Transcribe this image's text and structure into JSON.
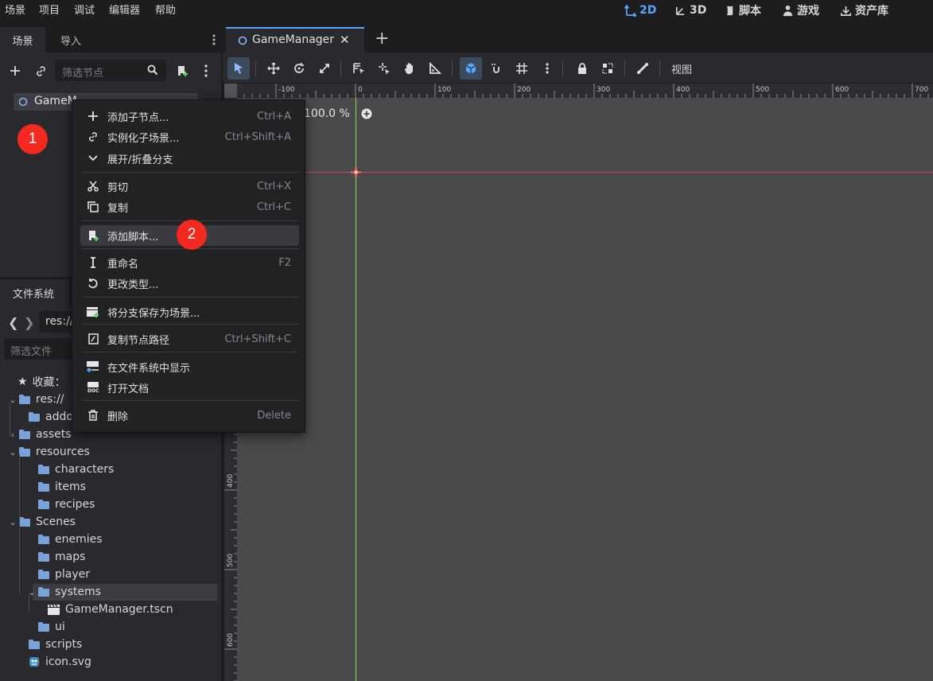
{
  "menubar": {
    "items": [
      "场景",
      "项目",
      "调试",
      "编辑器",
      "帮助"
    ],
    "workspaces": [
      "2D",
      "3D",
      "脚本",
      "游戏",
      "资产库"
    ]
  },
  "scene_dock": {
    "tabs": [
      "场景",
      "导入"
    ],
    "filter_placeholder": "筛选节点",
    "root_node": "GameM"
  },
  "editor_tab": {
    "title": "GameManager",
    "close": "✕",
    "add": "+"
  },
  "toolbar": {
    "view_label": "视图"
  },
  "rulers": {
    "h_labels": [
      "-100",
      "0",
      "100",
      "200",
      "300",
      "400",
      "500",
      "600",
      "700"
    ],
    "v_labels": [
      "400",
      "500",
      "600"
    ]
  },
  "viewport": {
    "zoom": "100.0 %"
  },
  "context_menu": {
    "items": [
      {
        "label": "添加子节点...",
        "shortcut": "Ctrl+A",
        "icon": "plus-icon"
      },
      {
        "label": "实例化子场景...",
        "shortcut": "Ctrl+Shift+A",
        "icon": "link-icon"
      },
      {
        "label": "展开/折叠分支",
        "shortcut": "",
        "icon": "chevron-down-icon"
      },
      {
        "label": "剪切",
        "shortcut": "Ctrl+X",
        "icon": "scissors-icon"
      },
      {
        "label": "复制",
        "shortcut": "Ctrl+C",
        "icon": "copy-icon"
      },
      {
        "label": "添加脚本...",
        "shortcut": "",
        "icon": "script-add-icon"
      },
      {
        "label": "重命名",
        "shortcut": "F2",
        "icon": "text-cursor-icon"
      },
      {
        "label": "更改类型...",
        "shortcut": "",
        "icon": "reload-icon"
      },
      {
        "label": "将分支保存为场景...",
        "shortcut": "",
        "icon": "save-scene-icon"
      },
      {
        "label": "复制节点路径",
        "shortcut": "Ctrl+Shift+C",
        "icon": "copy-path-icon"
      },
      {
        "label": "在文件系统中显示",
        "shortcut": "",
        "icon": "filesystem-icon"
      },
      {
        "label": "打开文档",
        "shortcut": "",
        "icon": "doc-icon"
      },
      {
        "label": "删除",
        "shortcut": "Delete",
        "icon": "trash-icon"
      }
    ]
  },
  "annotations": {
    "badge1": "1",
    "badge2": "2"
  },
  "filesystem": {
    "tab": "文件系统",
    "path": "res://",
    "filter_placeholder": "筛选文件",
    "favorites": "收藏：",
    "tree": [
      {
        "label": "res://",
        "caret": "v",
        "type": "folder"
      },
      {
        "label": "addons",
        "caret": "",
        "type": "folder"
      },
      {
        "label": "assets",
        "caret": ">",
        "type": "folder"
      },
      {
        "label": "resources",
        "caret": "v",
        "type": "folder"
      },
      {
        "label": "characters",
        "caret": "",
        "type": "folder"
      },
      {
        "label": "items",
        "caret": "",
        "type": "folder"
      },
      {
        "label": "recipes",
        "caret": "",
        "type": "folder"
      },
      {
        "label": "Scenes",
        "caret": "v",
        "type": "folder"
      },
      {
        "label": "enemies",
        "caret": "",
        "type": "folder"
      },
      {
        "label": "maps",
        "caret": "",
        "type": "folder"
      },
      {
        "label": "player",
        "caret": "",
        "type": "folder"
      },
      {
        "label": "systems",
        "caret": "v",
        "type": "folder"
      },
      {
        "label": "GameManager.tscn",
        "caret": "",
        "type": "scene"
      },
      {
        "label": "ui",
        "caret": "",
        "type": "folder"
      },
      {
        "label": "scripts",
        "caret": "",
        "type": "folder"
      },
      {
        "label": "icon.svg",
        "caret": "",
        "type": "image"
      }
    ]
  },
  "colors": {
    "accent": "#5aa6ff",
    "badge": "#f42a20",
    "folder": "#7aa2d8"
  }
}
